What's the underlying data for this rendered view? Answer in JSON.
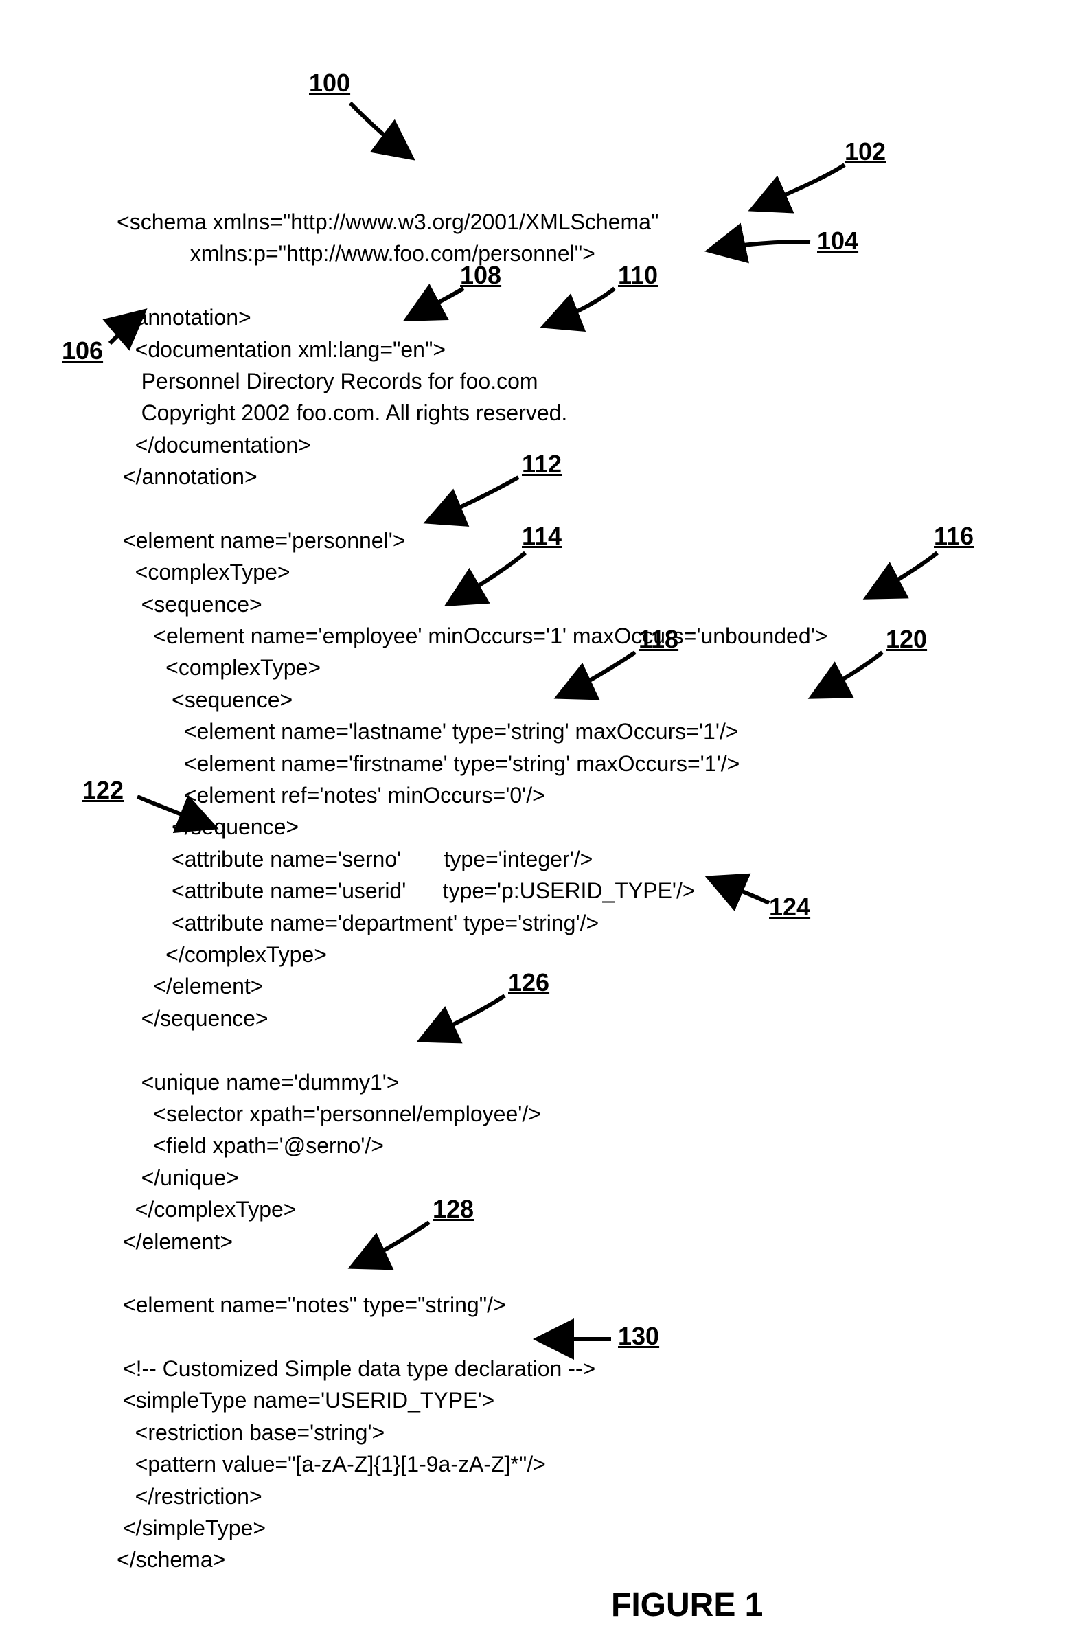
{
  "figure": {
    "caption": "FIGURE 1"
  },
  "refs": {
    "r100": "100",
    "r102": "102",
    "r104": "104",
    "r106": "106",
    "r108": "108",
    "r110": "110",
    "r112": "112",
    "r114": "114",
    "r116": "116",
    "r118": "118",
    "r120": "120",
    "r122": "122",
    "r124": "124",
    "r126": "126",
    "r128": "128",
    "r130": "130"
  },
  "code": {
    "l01": "<schema xmlns=\"http://www.w3.org/2001/XMLSchema\"",
    "l02": "            xmlns:p=\"http://www.foo.com/personnel\">",
    "l03": "",
    "l04": " <annotation>",
    "l05": "   <documentation xml:lang=\"en\">",
    "l06": "    Personnel Directory Records for foo.com",
    "l07": "    Copyright 2002 foo.com. All rights reserved.",
    "l08": "   </documentation>",
    "l09": " </annotation>",
    "l10": "",
    "l11": " <element name='personnel'>",
    "l12": "   <complexType>",
    "l13": "    <sequence>",
    "l14": "      <element name='employee' minOccurs='1' maxOccurs='unbounded'>",
    "l15": "        <complexType>",
    "l16": "         <sequence>",
    "l17": "           <element name='lastname' type='string' maxOccurs='1'/>",
    "l18": "           <element name='firstname' type='string' maxOccurs='1'/>",
    "l19": "           <element ref='notes' minOccurs='0'/>",
    "l20": "         </sequence>",
    "l21": "         <attribute name='serno'       type='integer'/>",
    "l22": "         <attribute name='userid'      type='p:USERID_TYPE'/>",
    "l23": "         <attribute name='department' type='string'/>",
    "l24": "        </complexType>",
    "l25": "      </element>",
    "l26": "    </sequence>",
    "l27": "",
    "l28": "    <unique name='dummy1'>",
    "l29": "      <selector xpath='personnel/employee'/>",
    "l30": "      <field xpath='@serno'/>",
    "l31": "    </unique>",
    "l32": "   </complexType>",
    "l33": " </element>",
    "l34": "",
    "l35": " <element name=\"notes\" type=\"string\"/>",
    "l36": "",
    "l37": " <!-- Customized Simple data type declaration -->",
    "l38": " <simpleType name='USERID_TYPE'>",
    "l39": "   <restriction base='string'>",
    "l40": "   <pattern value=\"[a-zA-Z]{1}[1-9a-zA-Z]*\"/>",
    "l41": "   </restriction>",
    "l42": " </simpleType>",
    "l43": "</schema>"
  }
}
